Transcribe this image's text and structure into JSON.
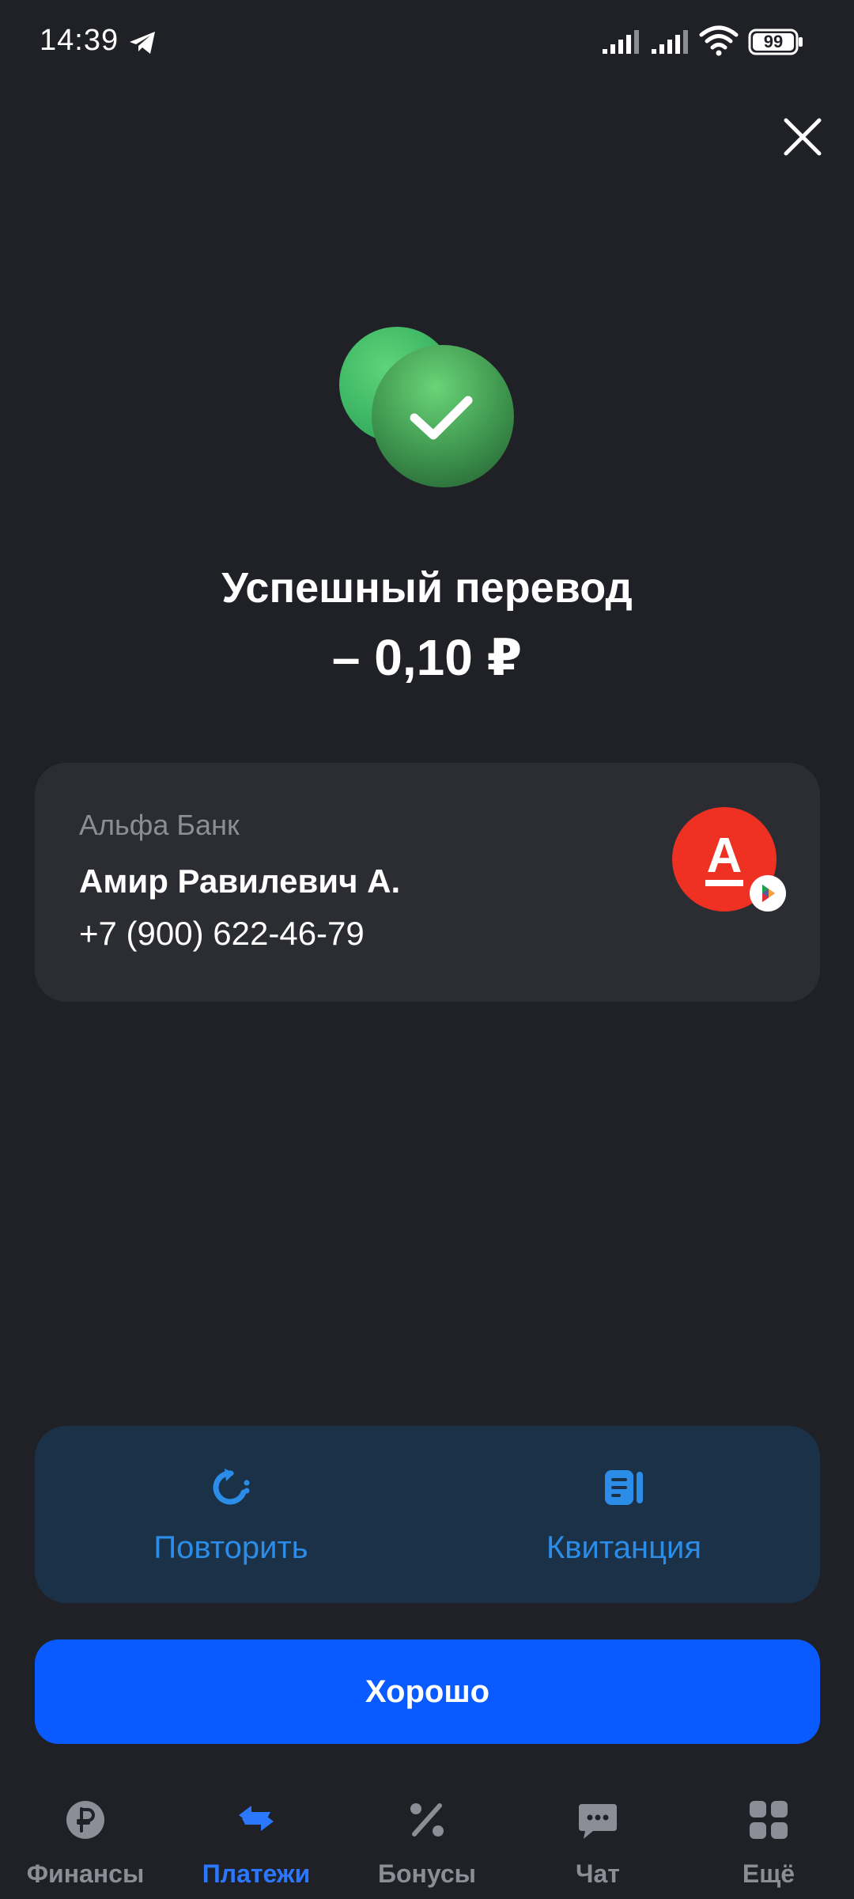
{
  "status_bar": {
    "time": "14:39",
    "battery": "99",
    "icons": [
      "telegram-icon",
      "signal-icon",
      "signal-icon",
      "wifi-icon",
      "battery-icon"
    ]
  },
  "header": {
    "close_icon": "close-icon"
  },
  "result": {
    "title": "Успешный перевод",
    "amount": "– 0,10 ₽",
    "icon": "check-icon",
    "accent": "#5ccf6a"
  },
  "recipient": {
    "bank": "Альфа Банк",
    "name": "Амир Равилевич А.",
    "phone": "+7 (900) 622-46-79",
    "logo_letter": "А",
    "logo_color": "#ef3124"
  },
  "actions": {
    "repeat_label": "Повторить",
    "receipt_label": "Квитанция",
    "accent": "#2b8de8"
  },
  "ok_button": {
    "label": "Хорошо",
    "color": "#0a5bff"
  },
  "nav": {
    "items": [
      {
        "label": "Финансы",
        "icon": "ruble-icon"
      },
      {
        "label": "Платежи",
        "icon": "transfer-icon",
        "active": true
      },
      {
        "label": "Бонусы",
        "icon": "percent-icon"
      },
      {
        "label": "Чат",
        "icon": "chat-icon"
      },
      {
        "label": "Ещё",
        "icon": "grid-icon"
      }
    ],
    "active_color": "#2b78ff"
  }
}
